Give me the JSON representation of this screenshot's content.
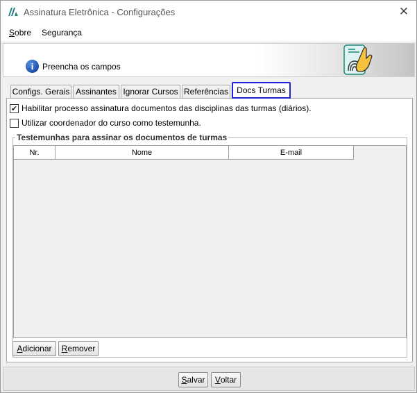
{
  "window": {
    "title": "Assinatura Eletrônica - Configurações",
    "close_glyph": "✕"
  },
  "menu": {
    "items": [
      {
        "label_first": "S",
        "label_rest": "obre"
      },
      {
        "label_first": "",
        "label_rest": "Segurança"
      }
    ]
  },
  "banner": {
    "text": "Preencha os campos",
    "info_glyph": "i",
    "icons": [
      "info-icon",
      "fingerprint-hand-icon"
    ]
  },
  "tabs": [
    {
      "label": "Configs. Gerais",
      "active": false
    },
    {
      "label": "Assinantes",
      "active": false
    },
    {
      "label": "Ignorar Cursos",
      "active": false
    },
    {
      "label": "Referências",
      "active": false
    },
    {
      "label": "Docs Turmas",
      "active": true
    }
  ],
  "options": {
    "enable_signing": {
      "label": "Habilitar processo assinatura documentos das disciplinas das turmas (diários).",
      "checked": true,
      "glyph": "✔"
    },
    "use_coordinator": {
      "label": "Utilizar coordenador do curso como testemunha.",
      "checked": false,
      "glyph": ""
    }
  },
  "witnesses": {
    "title": "Testemunhas para assinar os documentos de turmas",
    "columns": [
      "Nr.",
      "Nome",
      "E-mail"
    ],
    "rows": []
  },
  "buttons": {
    "add": {
      "first": "A",
      "rest": "dicionar"
    },
    "remove": {
      "first": "R",
      "rest": "emover"
    },
    "save": {
      "first": "S",
      "rest": "alvar"
    },
    "back": {
      "first": "V",
      "rest": "oltar"
    }
  },
  "colors": {
    "active_tab_border": "#1e22d6",
    "info_icon": "#1a4fa8",
    "logo": "#1a8a7a"
  }
}
